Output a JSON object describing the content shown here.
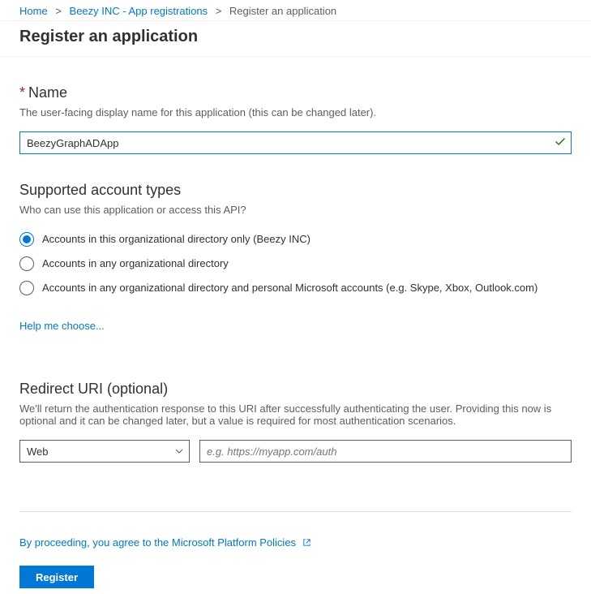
{
  "breadcrumb": {
    "home": "Home",
    "parent": "Beezy INC - App registrations",
    "current": "Register an application"
  },
  "page_title": "Register an application",
  "name_section": {
    "label": "Name",
    "desc": "The user-facing display name for this application (this can be changed later).",
    "value": "BeezyGraphADApp"
  },
  "account_types": {
    "title": "Supported account types",
    "desc": "Who can use this application or access this API?",
    "options": [
      "Accounts in this organizational directory only (Beezy INC)",
      "Accounts in any organizational directory",
      "Accounts in any organizational directory and personal Microsoft accounts (e.g. Skype, Xbox, Outlook.com)"
    ],
    "selected_index": 0,
    "help_link": "Help me choose..."
  },
  "redirect": {
    "title": "Redirect URI (optional)",
    "desc": "We'll return the authentication response to this URI after successfully authenticating the user. Providing this now is optional and it can be changed later, but a value is required for most authentication scenarios.",
    "type_value": "Web",
    "uri_placeholder": "e.g. https://myapp.com/auth"
  },
  "footer": {
    "agree_text": "By proceeding, you agree to the Microsoft Platform Policies",
    "register_label": "Register"
  }
}
